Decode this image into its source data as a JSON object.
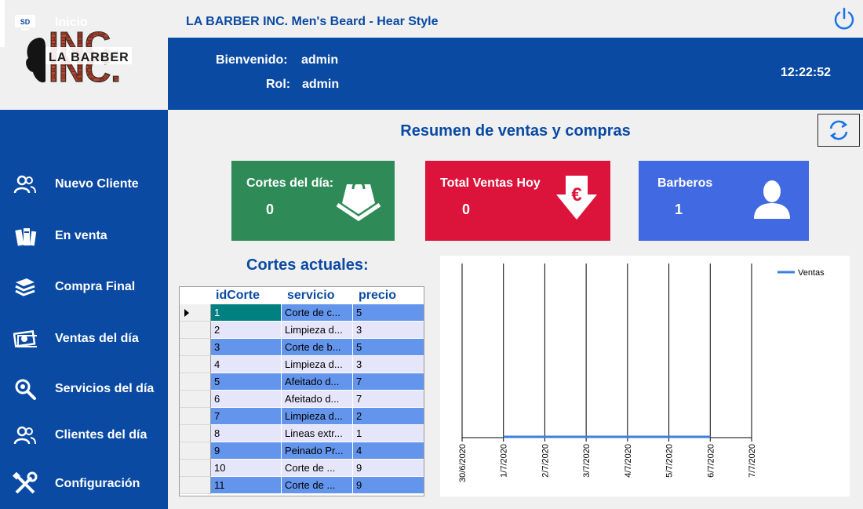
{
  "app_title": "LA BARBER INC. Men's Beard - Hear Style",
  "logo": {
    "text_top": "INC.",
    "text_mid": "LA BARBER",
    "text_bottom": "INC."
  },
  "header": {
    "welcome_label": "Bienvenido:",
    "welcome_value": "admin",
    "role_label": "Rol:",
    "role_value": "admin",
    "clock": "12:22:52"
  },
  "sidebar": {
    "items": [
      {
        "label": "Inicio",
        "icon": "home-icon"
      },
      {
        "label": "Nuevo Cliente",
        "icon": "users-icon"
      },
      {
        "label": "En venta",
        "icon": "books-icon"
      },
      {
        "label": "Compra Final",
        "icon": "stack-icon"
      },
      {
        "label": "Ventas del día",
        "icon": "money-icon"
      },
      {
        "label": "Servicios del día",
        "icon": "search-icon"
      },
      {
        "label": "Clientes del día",
        "icon": "users-icon"
      },
      {
        "label": "Configuración",
        "icon": "tools-icon"
      }
    ]
  },
  "summary": {
    "title": "Resumen de ventas y compras",
    "cards": [
      {
        "title": "Cortes del día:",
        "value": "0",
        "color": "#2e8b57",
        "icon": "shopping-bag-icon"
      },
      {
        "title": "Total Ventas Hoy",
        "value": "0",
        "color": "#dc143c",
        "icon": "euro-down-icon"
      },
      {
        "title": "Barberos",
        "value": "1",
        "color": "#4169e1",
        "icon": "user-icon"
      }
    ]
  },
  "grid": {
    "title": "Cortes actuales:",
    "columns": [
      "idCorte",
      "servicio",
      "precio"
    ],
    "rows": [
      [
        "1",
        "Corte de c...",
        "5"
      ],
      [
        "2",
        "Limpieza d...",
        "3"
      ],
      [
        "3",
        "Corte de b...",
        "5"
      ],
      [
        "4",
        "Limpieza d...",
        "3"
      ],
      [
        "5",
        "Afeitado d...",
        "7"
      ],
      [
        "6",
        "Afeitado d...",
        "7"
      ],
      [
        "7",
        "Limpieza d...",
        "2"
      ],
      [
        "8",
        "Lineas extr...",
        "1"
      ],
      [
        "9",
        "Peinado Pr...",
        "4"
      ],
      [
        "10",
        "Corte de ...",
        "9"
      ],
      [
        "11",
        "Corte de ...",
        "9"
      ]
    ]
  },
  "chart_data": {
    "type": "line",
    "x": [
      "30/6/2020",
      "1/7/2020",
      "2/7/2020",
      "3/7/2020",
      "4/7/2020",
      "5/7/2020",
      "6/7/2020",
      "7/7/2020"
    ],
    "series": [
      {
        "name": "Ventas",
        "x": [
          "1/7/2020",
          "2/7/2020",
          "3/7/2020",
          "4/7/2020",
          "5/7/2020",
          "6/7/2020"
        ],
        "values": [
          0,
          0,
          0,
          0,
          0,
          0
        ]
      }
    ],
    "legend": "top-right",
    "grid": true,
    "color": "#3b7fe0"
  }
}
